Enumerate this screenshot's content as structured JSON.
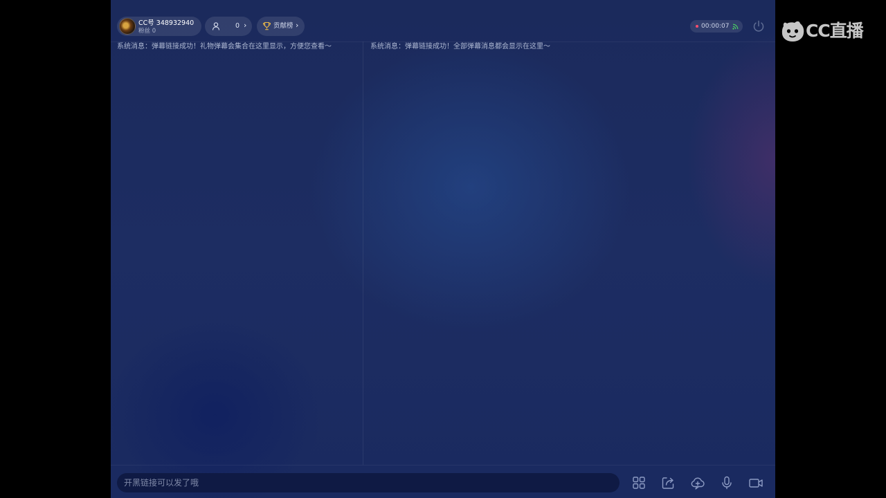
{
  "header": {
    "cc_id": "CC号 348932940",
    "fans": "粉丝 0",
    "viewer_count": "0",
    "contribution_label": "贡献榜",
    "chevron": "›",
    "live_timer": "00:00:07"
  },
  "messages": {
    "gift_panel": "系统消息：弹幕链接成功！礼物弹幕会集合在这里显示，方便您查看～",
    "all_panel": "系统消息：弹幕链接成功！全部弹幕消息都会显示在这里～"
  },
  "input": {
    "placeholder": "开黑链接可以发了哦"
  },
  "toolbar": {
    "icons": [
      "apps-grid-icon",
      "share-icon",
      "cloud-add-icon",
      "microphone-icon",
      "camera-icon"
    ]
  },
  "brand": {
    "logo_text": "CC直播"
  },
  "colors": {
    "background": "#1b2a5c",
    "record_dot": "#ff4d6d",
    "signal": "#4cd964",
    "trophy": "#e8b84a"
  }
}
